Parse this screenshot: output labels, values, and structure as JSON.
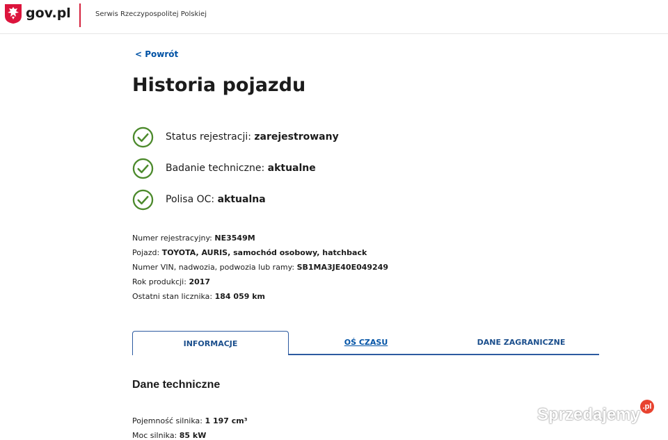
{
  "header": {
    "logo_text": "gov.pl",
    "service_name": "Serwis Rzeczypospolitej Polskiej",
    "accent_color": "#d4213d"
  },
  "nav": {
    "back_label": "< Powrót"
  },
  "page": {
    "title": "Historia pojazdu"
  },
  "status": [
    {
      "label": "Status rejestracji:",
      "value": "zarejestrowany",
      "icon": "check-circle-icon"
    },
    {
      "label": "Badanie techniczne:",
      "value": "aktualne",
      "icon": "check-circle-icon"
    },
    {
      "label": "Polisa OC:",
      "value": "aktualna",
      "icon": "check-circle-icon"
    }
  ],
  "vehicle": [
    {
      "label": "Numer rejestracyjny:",
      "value": "NE3549M"
    },
    {
      "label": "Pojazd:",
      "value": "TOYOTA, AURIS, samochód osobowy, hatchback"
    },
    {
      "label": "Numer VIN, nadwozia, podwozia lub ramy:",
      "value": "SB1MA3JE40E049249"
    },
    {
      "label": "Rok produkcji:",
      "value": "2017"
    },
    {
      "label": "Ostatni stan licznika:",
      "value": "184 059 km"
    }
  ],
  "tabs": {
    "informacje": "INFORMACJE",
    "os_czasu": "OŚ CZASU",
    "dane_zagraniczne": "DANE ZAGRANICZNE",
    "active": "INFORMACJE"
  },
  "tech": {
    "title": "Dane techniczne",
    "rows": [
      {
        "label": "Pojemność silnika:",
        "value": "1 197 cm³"
      },
      {
        "label": "Moc silnika:",
        "value": "85 kW"
      }
    ]
  },
  "watermark": {
    "text": "Sprzedajemy",
    "badge": ".pl"
  },
  "colors": {
    "check_green": "#4c8a2c",
    "link_blue": "#0052a5",
    "tab_border": "#2c5aa0"
  }
}
